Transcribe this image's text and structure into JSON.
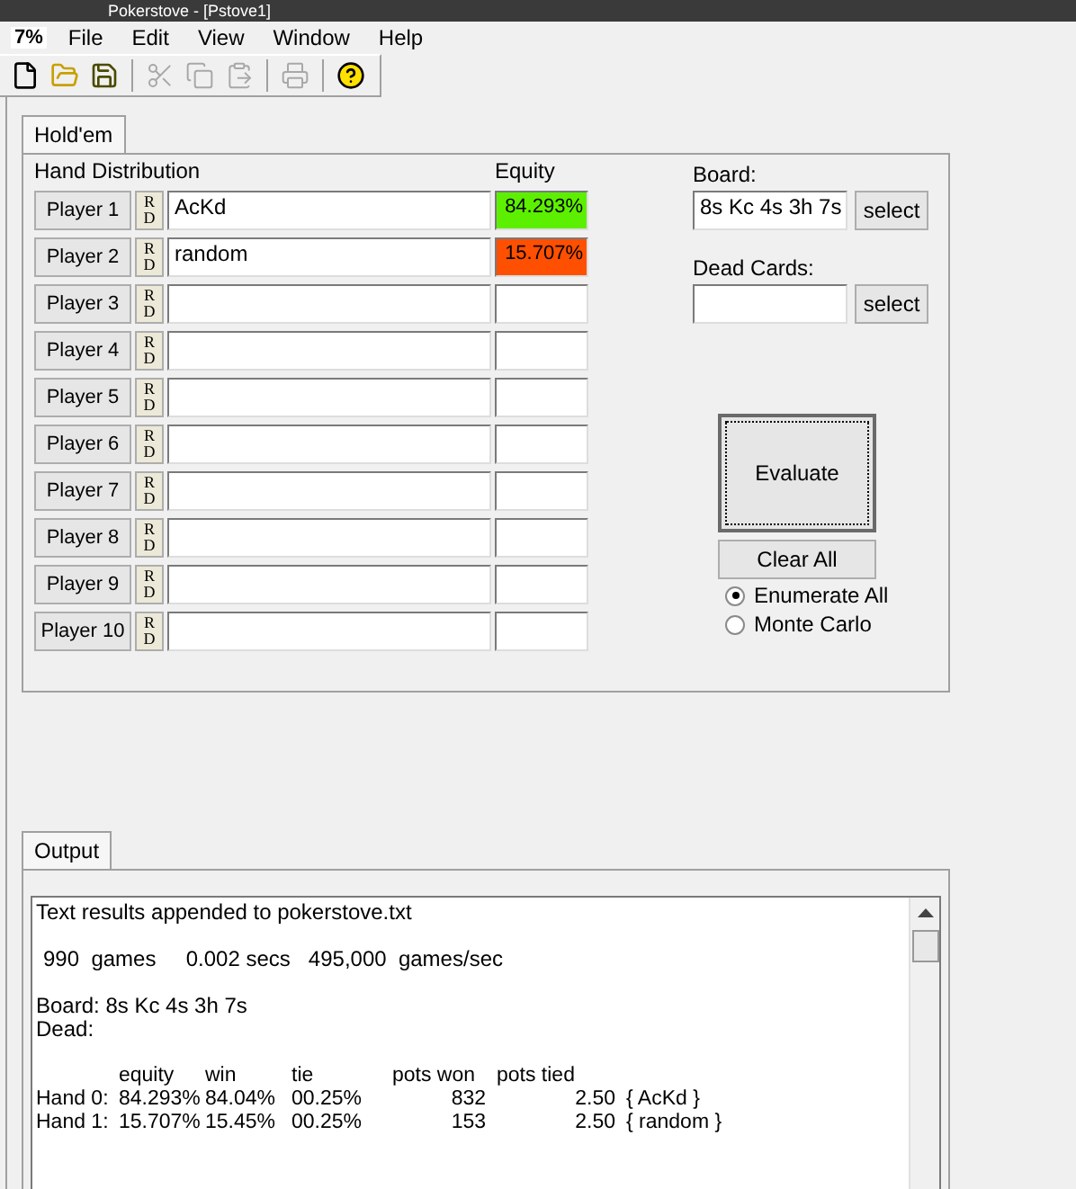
{
  "window": {
    "title": "Pokerstove - [Pstove1]"
  },
  "menu": {
    "app_icon": "7%",
    "items": [
      "File",
      "Edit",
      "View",
      "Window",
      "Help"
    ]
  },
  "toolbar": [
    {
      "kind": "new",
      "disabled": false
    },
    {
      "kind": "open",
      "disabled": false
    },
    {
      "kind": "save",
      "disabled": false
    },
    {
      "kind": "sep"
    },
    {
      "kind": "cut",
      "disabled": true
    },
    {
      "kind": "copy",
      "disabled": true
    },
    {
      "kind": "paste",
      "disabled": true
    },
    {
      "kind": "sep"
    },
    {
      "kind": "print",
      "disabled": true
    },
    {
      "kind": "sep"
    },
    {
      "kind": "help",
      "disabled": false
    }
  ],
  "tabs": [
    {
      "label": "Hold'em",
      "selected": true
    }
  ],
  "hand_header": "Hand Distribution",
  "equity_header": "Equity",
  "players": [
    {
      "label": "Player 1",
      "r": "R",
      "d": "D",
      "hand": "AcKd",
      "equity": "84.293%",
      "color": "#5cf000"
    },
    {
      "label": "Player 2",
      "r": "R",
      "d": "D",
      "hand": "random",
      "equity": "15.707%",
      "color": "#ff4f00"
    },
    {
      "label": "Player 3",
      "r": "R",
      "d": "D"
    },
    {
      "label": "Player 4",
      "r": "R",
      "d": "D"
    },
    {
      "label": "Player 5",
      "r": "R",
      "d": "D"
    },
    {
      "label": "Player 6",
      "r": "R",
      "d": "D"
    },
    {
      "label": "Player 7",
      "r": "R",
      "d": "D"
    },
    {
      "label": "Player 8",
      "r": "R",
      "d": "D"
    },
    {
      "label": "Player 9",
      "r": "R",
      "d": "D"
    },
    {
      "label": "Player 10",
      "r": "R",
      "d": "D"
    }
  ],
  "board": {
    "label": "Board:",
    "value": "8s Kc 4s 3h 7s",
    "button": "select"
  },
  "dead": {
    "label": "Dead Cards:",
    "button": "select"
  },
  "evaluate": "Evaluate",
  "clear": "Clear All",
  "modes": [
    {
      "label": "Enumerate All",
      "selected": true
    },
    {
      "label": "Monte Carlo",
      "selected": false
    }
  ],
  "output_tabs": [
    {
      "label": "Output",
      "selected": true
    }
  ],
  "output": {
    "lines": [
      "Text results appended to pokerstove.txt",
      "990  games     0.002 secs   495,000  games/sec"
    ],
    "board": "Board: 8s Kc 4s 3h 7s",
    "dead": "Dead:",
    "columns": [
      "",
      "equity",
      "win",
      "tie",
      "pots won",
      "pots tied"
    ],
    "rows": [
      [
        "Hand 0:",
        "84.293%",
        "84.04%",
        "00.25%",
        "832",
        "2.50",
        "{ AcKd }"
      ],
      [
        "Hand 1:",
        "15.707%",
        "15.45%",
        "00.25%",
        "153",
        "2.50",
        "{ random }"
      ]
    ]
  }
}
